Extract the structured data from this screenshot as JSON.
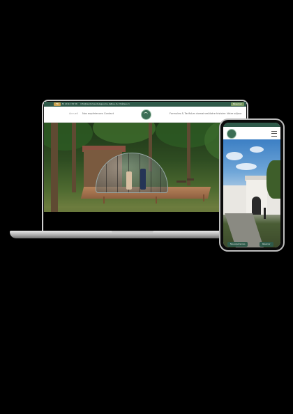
{
  "laptop": {
    "topbar": {
      "phone": "+ 32 (0)12 34 56",
      "email": "info@lesdomesdelagaume.be",
      "address": "Rue du Château 1",
      "cta": "Réserver",
      "lang": "FR"
    },
    "nav": {
      "left": [
        "Accueil",
        "Nos expériences",
        "Contact"
      ],
      "right": [
        "Formules & Tarifs",
        "Les domaines",
        "Notre histoire",
        "Votre séjour"
      ]
    }
  },
  "phone": {
    "buttons": [
      "Nos expériences",
      "Réserver"
    ]
  },
  "colors": {
    "brand_green": "#2f5a4a",
    "accent_gold": "#c9a04e"
  }
}
